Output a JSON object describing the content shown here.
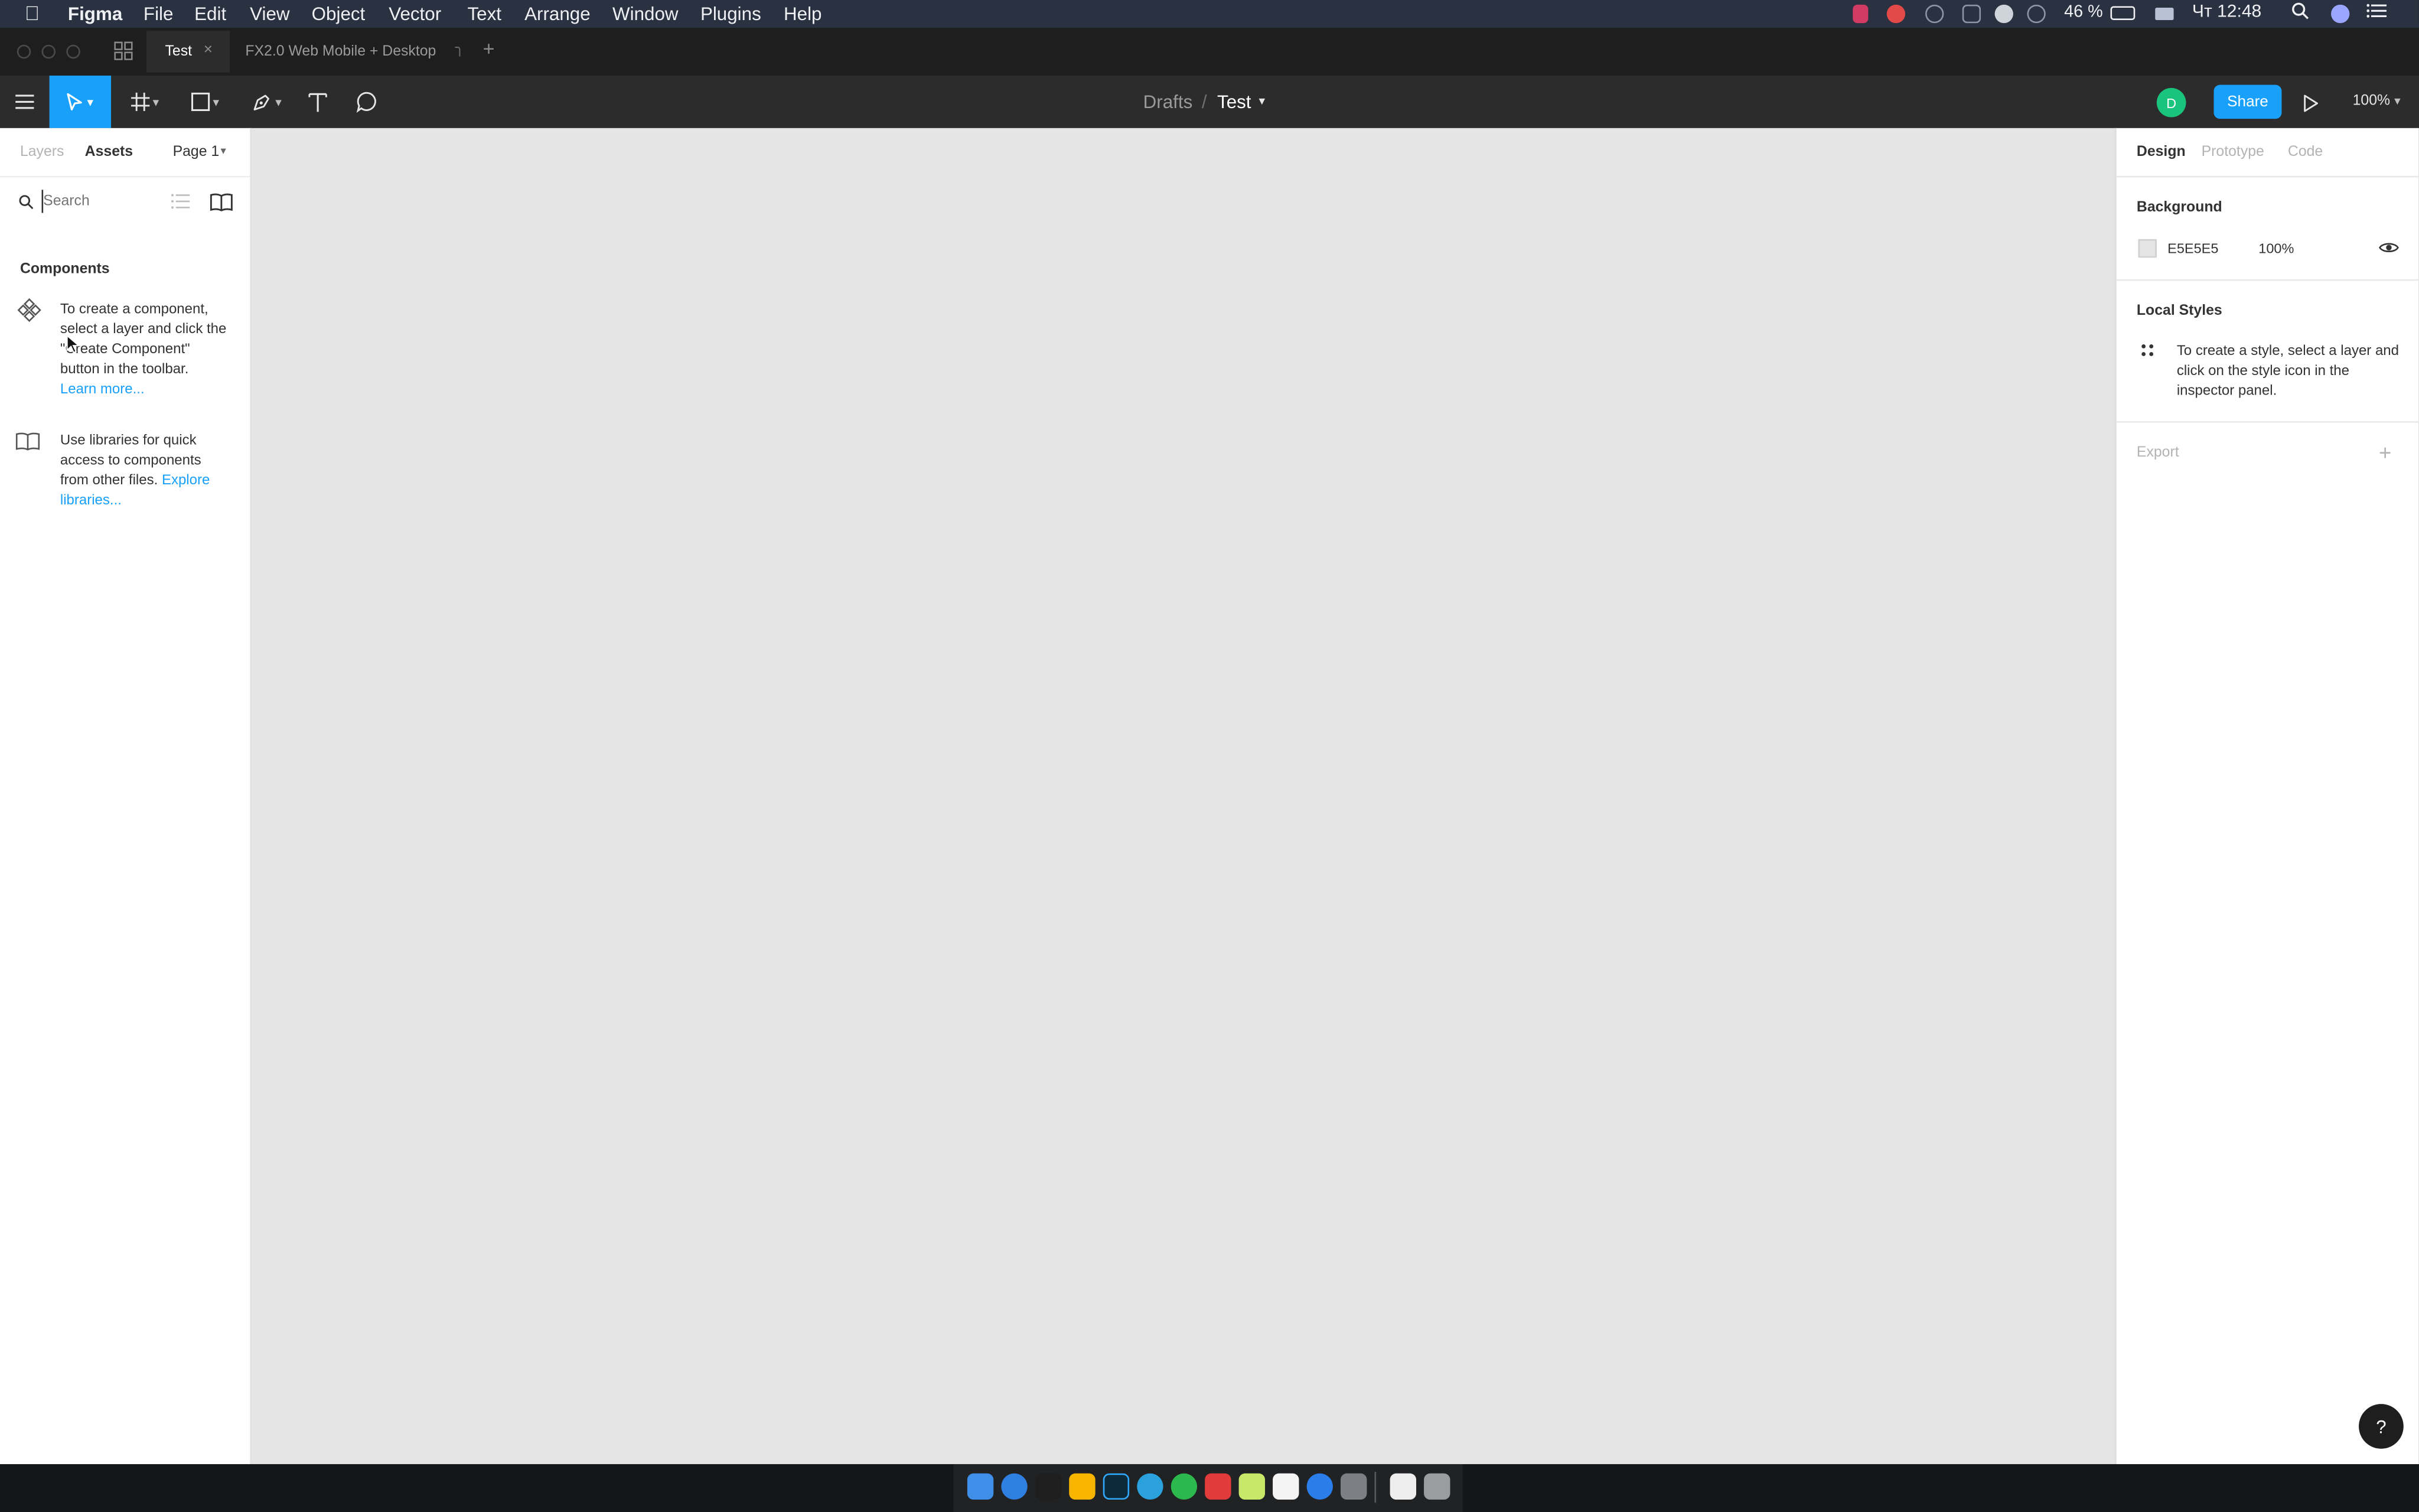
{
  "menubar": {
    "items": [
      "Figma",
      "File",
      "Edit",
      "View",
      "Object",
      "Vector",
      "Text",
      "Arrange",
      "Window",
      "Plugins",
      "Help"
    ],
    "battery": "46 %",
    "clock": "Чт 12:48"
  },
  "tabs": {
    "active": "Test",
    "inactive": "FX2.0 Web Mobile + Desktop"
  },
  "toolbar": {
    "breadcrumb_parent": "Drafts",
    "breadcrumb_sep": "/",
    "file_name": "Test",
    "avatar_initial": "D",
    "share_label": "Share",
    "zoom": "100%"
  },
  "left_panel": {
    "tab_layers": "Layers",
    "tab_assets": "Assets",
    "page_selector": "Page 1",
    "search_placeholder": "Search",
    "components_heading": "Components",
    "components_help": "To create a component, select a layer and click the \"Create Component\" button in the toolbar.",
    "learn_more": "Learn more...",
    "libraries_help": "Use libraries for quick access to components from other files.",
    "explore_libraries": "Explore libraries..."
  },
  "right_panel": {
    "tab_design": "Design",
    "tab_prototype": "Prototype",
    "tab_code": "Code",
    "background_heading": "Background",
    "background_hex": "E5E5E5",
    "background_opacity": "100%",
    "local_styles_heading": "Local Styles",
    "local_styles_help": "To create a style, select a layer and click on the style icon in the inspector panel.",
    "export_heading": "Export"
  },
  "help_button": "?",
  "colors": {
    "accent": "#18a0fb",
    "avatar": "#1bc47d",
    "canvas": "#e5e5e5",
    "toolbar": "#2c2c2c",
    "menubar": "#2a3140"
  }
}
